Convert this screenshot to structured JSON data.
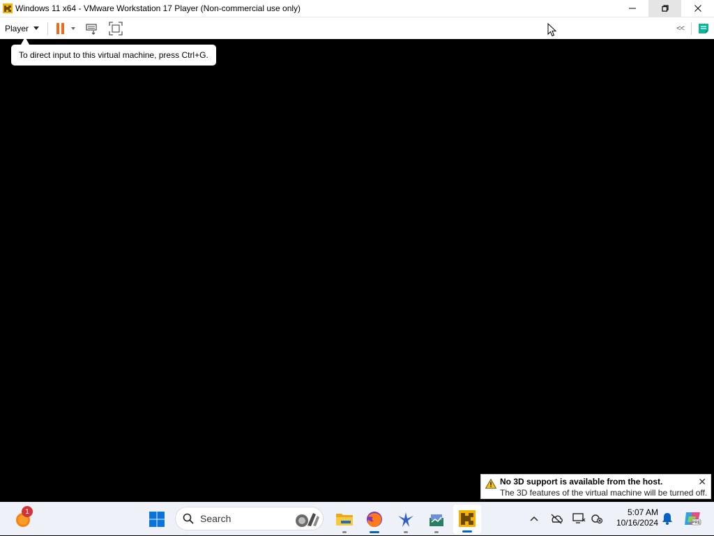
{
  "window": {
    "title": "Windows 11 x64 - VMware Workstation 17 Player (Non-commercial use only)"
  },
  "toolbar": {
    "player_label": "Player",
    "icons": [
      "pause-icon",
      "send-ctrl-alt-del-icon",
      "fullscreen-icon",
      "collapse-chevron-icon",
      "notes-icon"
    ],
    "collapse_label": "<<"
  },
  "tooltip": {
    "text": "To direct input to this virtual machine, press Ctrl+G."
  },
  "notification": {
    "title": "No 3D support is available from the host.",
    "body": "The 3D features of the virtual machine will be turned off.",
    "close": "✕"
  },
  "taskbar": {
    "weather_badge": "1",
    "search_placeholder": "Search",
    "apps": [
      "start-icon",
      "file-explorer-icon",
      "firefox-icon",
      "app-bird-icon",
      "app-chart-icon",
      "vmware-icon"
    ],
    "tray": {
      "time": "5:07 AM",
      "date": "10/16/2024"
    }
  },
  "colors": {
    "accent_orange": "#ef6a1b",
    "windows_blue": "#0067c0",
    "taskbar_bg": "#eef1f7"
  }
}
